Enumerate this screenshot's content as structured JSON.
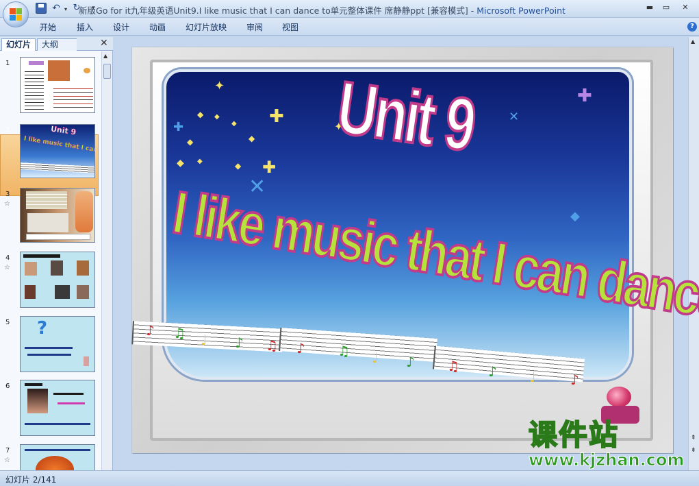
{
  "window": {
    "title": "新版Go for it九年级英语Unit9.I like music that I can dance to单元整体课件 席静静ppt [兼容模式]",
    "separator": " - ",
    "app_name": "Microsoft PowerPoint"
  },
  "quick_access": {
    "save_icon": "save-icon",
    "undo_icon": "undo-icon",
    "redo_icon": "redo-icon",
    "customize_icon": "customize-icon"
  },
  "window_controls": {
    "minimize": "▬",
    "restore": "▭",
    "close": "✕"
  },
  "ribbon": {
    "tabs": [
      "开始",
      "插入",
      "设计",
      "动画",
      "幻灯片放映",
      "审阅",
      "视图"
    ],
    "help_label": "?"
  },
  "panel": {
    "tabs": [
      "幻灯片",
      "大纲"
    ],
    "close_label": "✕",
    "slides": [
      {
        "number": "1",
        "has_star": false,
        "bg": "#ffffff"
      },
      {
        "number": "2",
        "has_star": false,
        "bg": "#2f63b8",
        "selected": true
      },
      {
        "number": "3",
        "has_star": true,
        "bg": "#e9e3d3"
      },
      {
        "number": "4",
        "has_star": true,
        "bg": "#bfe6f0"
      },
      {
        "number": "5",
        "has_star": false,
        "bg": "#bfe6f0"
      },
      {
        "number": "6",
        "has_star": false,
        "bg": "#bfe6f0"
      },
      {
        "number": "7",
        "has_star": true,
        "bg": "#bfe6f0"
      }
    ],
    "star_glyph": "☆"
  },
  "slide": {
    "unit_title": "Unit 9",
    "main_title": "I like music that I can dance to."
  },
  "watermark": {
    "title": "课件站",
    "url": "www.kjzhan.com"
  },
  "status": {
    "text": "幻灯片 2/141"
  },
  "colors": {
    "accent": "#1f4f9a",
    "title_stroke": "#c23a8a",
    "main_title_fill": "#b6e23c",
    "selection": "#f1b465"
  }
}
